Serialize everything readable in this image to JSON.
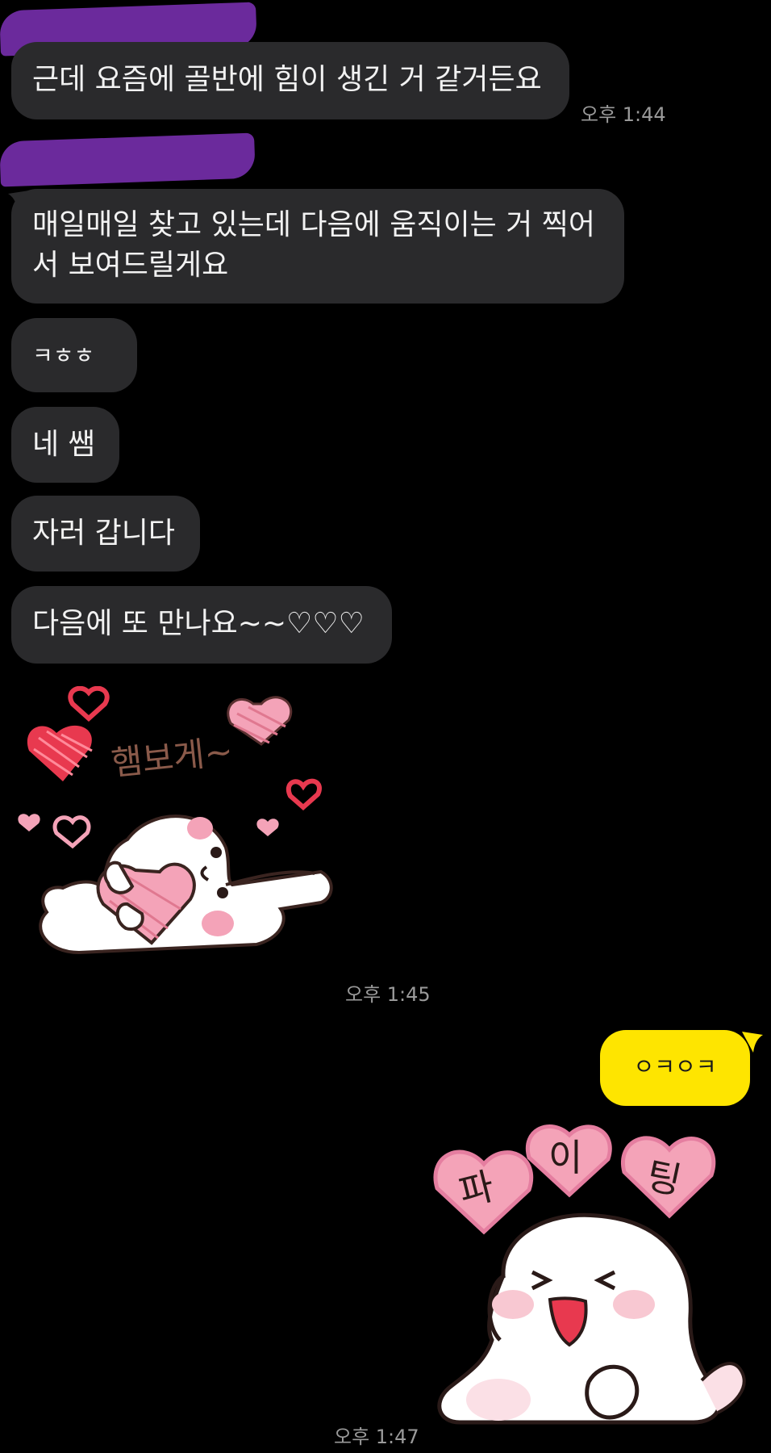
{
  "messages": [
    {
      "id": "m1",
      "text": "근데 요즘에 골반에 힘이 생긴 거 같거든요",
      "time": "오후 1:44"
    },
    {
      "id": "m2",
      "line1": "매일매일 찾고 있는데 다음에 움직이는 거 찍어",
      "line2": "서 보여드릴게요"
    },
    {
      "id": "m3",
      "text": "ㅋㅎㅎ"
    },
    {
      "id": "m4",
      "text": "네 쌤"
    },
    {
      "id": "m5",
      "text": "자러 갑니다"
    },
    {
      "id": "m6",
      "text": "다음에 또 만나요~~♡♡♡"
    }
  ],
  "stickers": {
    "left": {
      "caption": "햄보게~",
      "time": "오후 1:45"
    },
    "right": {
      "hearts": [
        "파",
        "이",
        "팅"
      ],
      "time": "오후 1:47"
    }
  },
  "my_message": {
    "text": "ㅇㅋㅇㅋ"
  },
  "colors": {
    "background": "#000000",
    "bubble": "#2a2a2c",
    "my_bubble": "#fee500",
    "redaction": "#6b2a9c",
    "heart_pink": "#f4a3b8",
    "heart_red": "#e8394f"
  }
}
